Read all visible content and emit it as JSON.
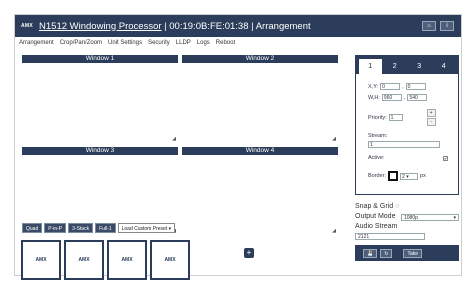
{
  "header": {
    "logo": "AMX",
    "title_device": "N1512 Windowing Processor",
    "title_rest": " | 00:19:0B:FE:01:38 | Arrangement",
    "btn_home": "⌂",
    "btn_info": "i"
  },
  "menu": [
    "Arrangement",
    "Crop/Pan/Zoom",
    "Unit Settings",
    "Security",
    "LLDP",
    "Logs",
    "Reboot"
  ],
  "windows": [
    {
      "label": "Window 1"
    },
    {
      "label": "Window 2"
    },
    {
      "label": "Window 3"
    },
    {
      "label": "Window 4"
    }
  ],
  "layout_buttons": [
    "Quad",
    "P-in-P",
    "3-Stack",
    "Full-1"
  ],
  "preset_select": "Load Custom Preset",
  "thumbnails": [
    "AMX",
    "AMX",
    "AMX",
    "AMX"
  ],
  "add_icon": "+",
  "panel": {
    "tabs": [
      "1",
      "2",
      "3",
      "4"
    ],
    "active_tab": "1",
    "xy_label": "X,Y:",
    "x_value": "0",
    "y_value": "0",
    "wh_label": "W,H:",
    "w_value": "960",
    "h_value": "540",
    "priority_label": "Priority:",
    "priority_value": "1",
    "stream_label": "Stream:",
    "stream_value": "1",
    "active_label": "Active:",
    "active_checked": "✔",
    "border_label": "Border:",
    "border_value": "2",
    "border_unit": "px"
  },
  "settings": {
    "snap_label": "Snap & Grid",
    "output_mode_label": "Output Mode",
    "output_mode_value": "1080p",
    "audio_stream_label": "Audio Stream",
    "audio_stream_value": "2121"
  },
  "actions": {
    "save": "💾",
    "refresh": "↻",
    "take": "Take"
  },
  "colors": {
    "primary": "#2b3d5a",
    "accent": "#4e5f7c"
  }
}
